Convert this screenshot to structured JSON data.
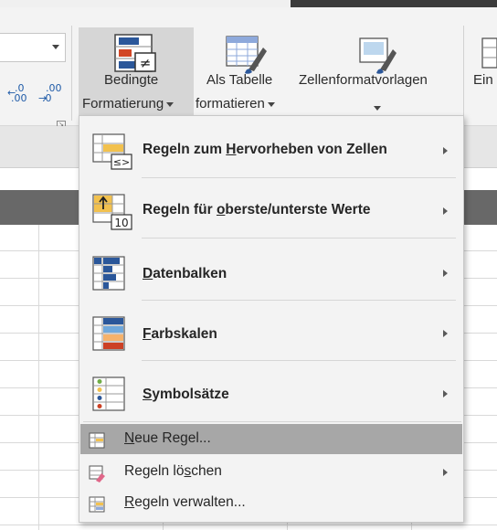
{
  "ribbon": {
    "decimal_increase": {
      "top": ".0",
      "bottom": ".00",
      "icon": "increase-decimal-icon"
    },
    "decimal_decrease": {
      "top": ".00",
      "bottom": ".0",
      "icon": "decrease-decimal-icon"
    },
    "conditional_formatting": {
      "line1": "Bedingte",
      "line2": "Formatierung",
      "icon": "conditional-formatting-icon"
    },
    "format_as_table": {
      "line1": "Als Tabelle",
      "line2": "formatieren",
      "icon": "format-as-table-icon"
    },
    "cell_styles": {
      "line1": "Zellenformatvorlagen",
      "icon": "cell-styles-icon"
    },
    "insert_partial": "Ein"
  },
  "menu": {
    "items": [
      {
        "pre": "Regeln zum ",
        "key": "H",
        "post": "ervorheben von Zellen",
        "icon": "highlight-cells-rules-icon",
        "submenu": true
      },
      {
        "pre": "Regeln für ",
        "key": "o",
        "post": "berste/unterste Werte",
        "icon": "top-bottom-rules-icon",
        "submenu": true
      },
      {
        "pre": "",
        "key": "D",
        "post": "atenbalken",
        "icon": "data-bars-icon",
        "submenu": true
      },
      {
        "pre": "",
        "key": "F",
        "post": "arbskalen",
        "icon": "color-scales-icon",
        "submenu": true
      },
      {
        "pre": "",
        "key": "S",
        "post": "ymbolsätze",
        "icon": "icon-sets-icon",
        "submenu": true
      },
      {
        "pre": "",
        "key": "N",
        "post": "eue Regel...",
        "icon": "new-rule-icon",
        "submenu": false,
        "hovered": true
      },
      {
        "pre": "Regeln lö",
        "key": "s",
        "post": "chen",
        "icon": "clear-rules-icon",
        "submenu": true
      },
      {
        "pre": "",
        "key": "R",
        "post": "egeln verwalten...",
        "icon": "manage-rules-icon",
        "submenu": false
      }
    ]
  },
  "colors": {
    "menu_background": "#f3f3f3",
    "menu_hover": "#a7a7a7",
    "ribbon_background": "#f3f3f3",
    "pressed_button": "#d6d6d6",
    "column_header_bar": "#686868",
    "accent_blue": "#2b579a",
    "accent_orange": "#ed7d31"
  }
}
